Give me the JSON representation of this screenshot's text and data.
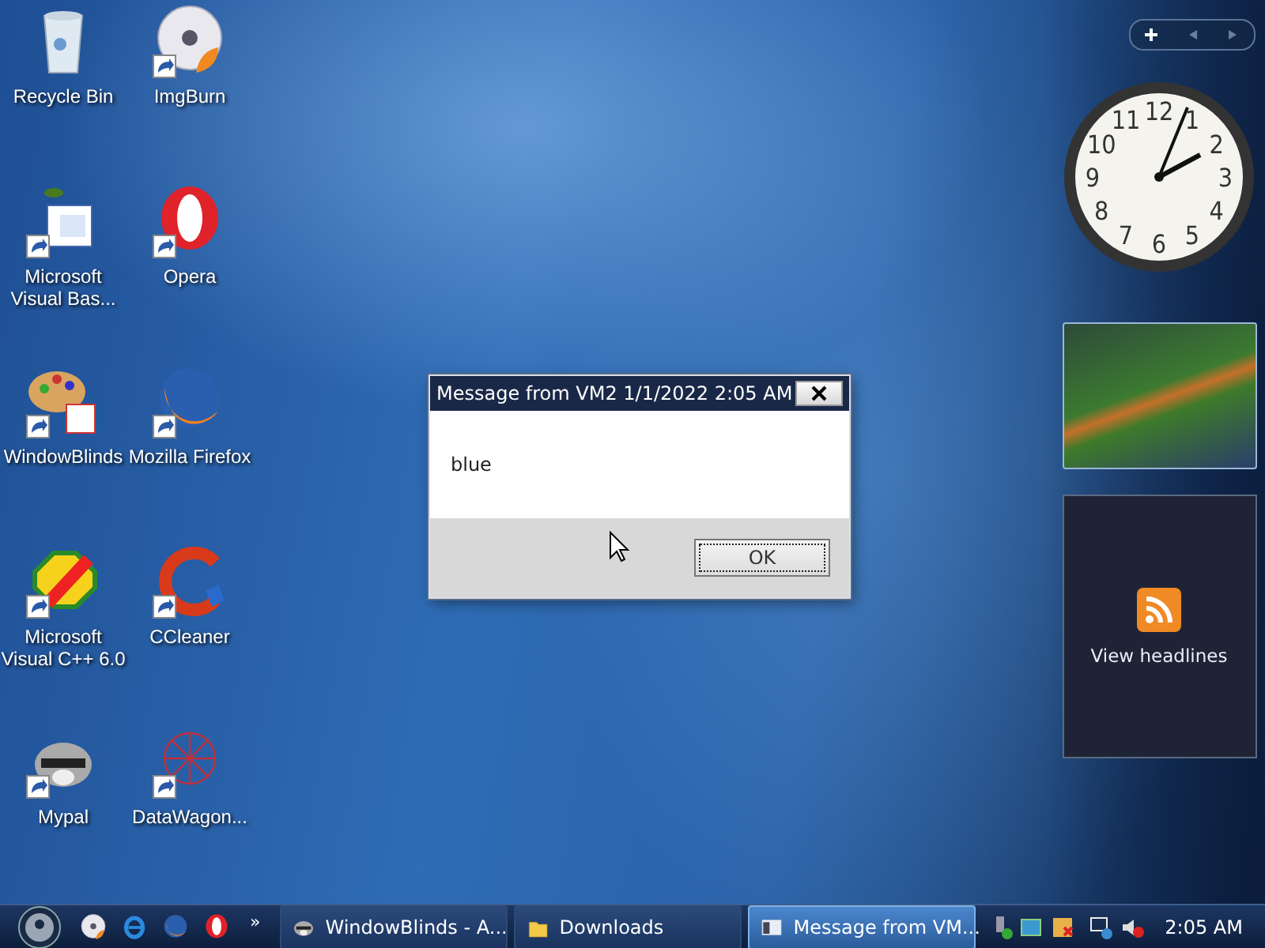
{
  "desktop_icons": [
    {
      "label": "Recycle Bin",
      "kind": "bin",
      "shortcut": false
    },
    {
      "label": "ImgBurn",
      "kind": "disc",
      "shortcut": true
    },
    {
      "label": "Microsoft Visual Bas...",
      "kind": "vb",
      "shortcut": true
    },
    {
      "label": "Opera",
      "kind": "opera",
      "shortcut": true
    },
    {
      "label": "WindowBlinds",
      "kind": "palette",
      "shortcut": true
    },
    {
      "label": "Mozilla Firefox",
      "kind": "firefox",
      "shortcut": true
    },
    {
      "label": "Microsoft Visual C++ 6.0",
      "kind": "vc",
      "shortcut": true
    },
    {
      "label": "CCleaner",
      "kind": "ccleaner",
      "shortcut": true
    },
    {
      "label": "Mypal",
      "kind": "raccoon",
      "shortcut": true
    },
    {
      "label": "DataWagon...",
      "kind": "net",
      "shortcut": true
    }
  ],
  "dialog": {
    "title": "Message from VM2 1/1/2022 2:05 AM",
    "message": "blue",
    "button": "OK"
  },
  "sidebar": {
    "clock": {
      "numerals": [
        "12",
        "11",
        "1",
        "10",
        "2",
        "9",
        "3",
        "8",
        "4",
        "7",
        "5",
        "6"
      ]
    },
    "feed_link": "View headlines"
  },
  "taskbar": {
    "quick_launch": [
      {
        "kind": "disc"
      },
      {
        "kind": "ie"
      },
      {
        "kind": "firefox"
      },
      {
        "kind": "opera"
      }
    ],
    "more": "»",
    "tasks": [
      {
        "label": "WindowBlinds - A...",
        "kind": "raccoon",
        "selected": false
      },
      {
        "label": "Downloads",
        "kind": "folder",
        "selected": false
      },
      {
        "label": "Message from VM...",
        "kind": "window",
        "selected": true
      }
    ],
    "clock": "2:05 AM"
  }
}
